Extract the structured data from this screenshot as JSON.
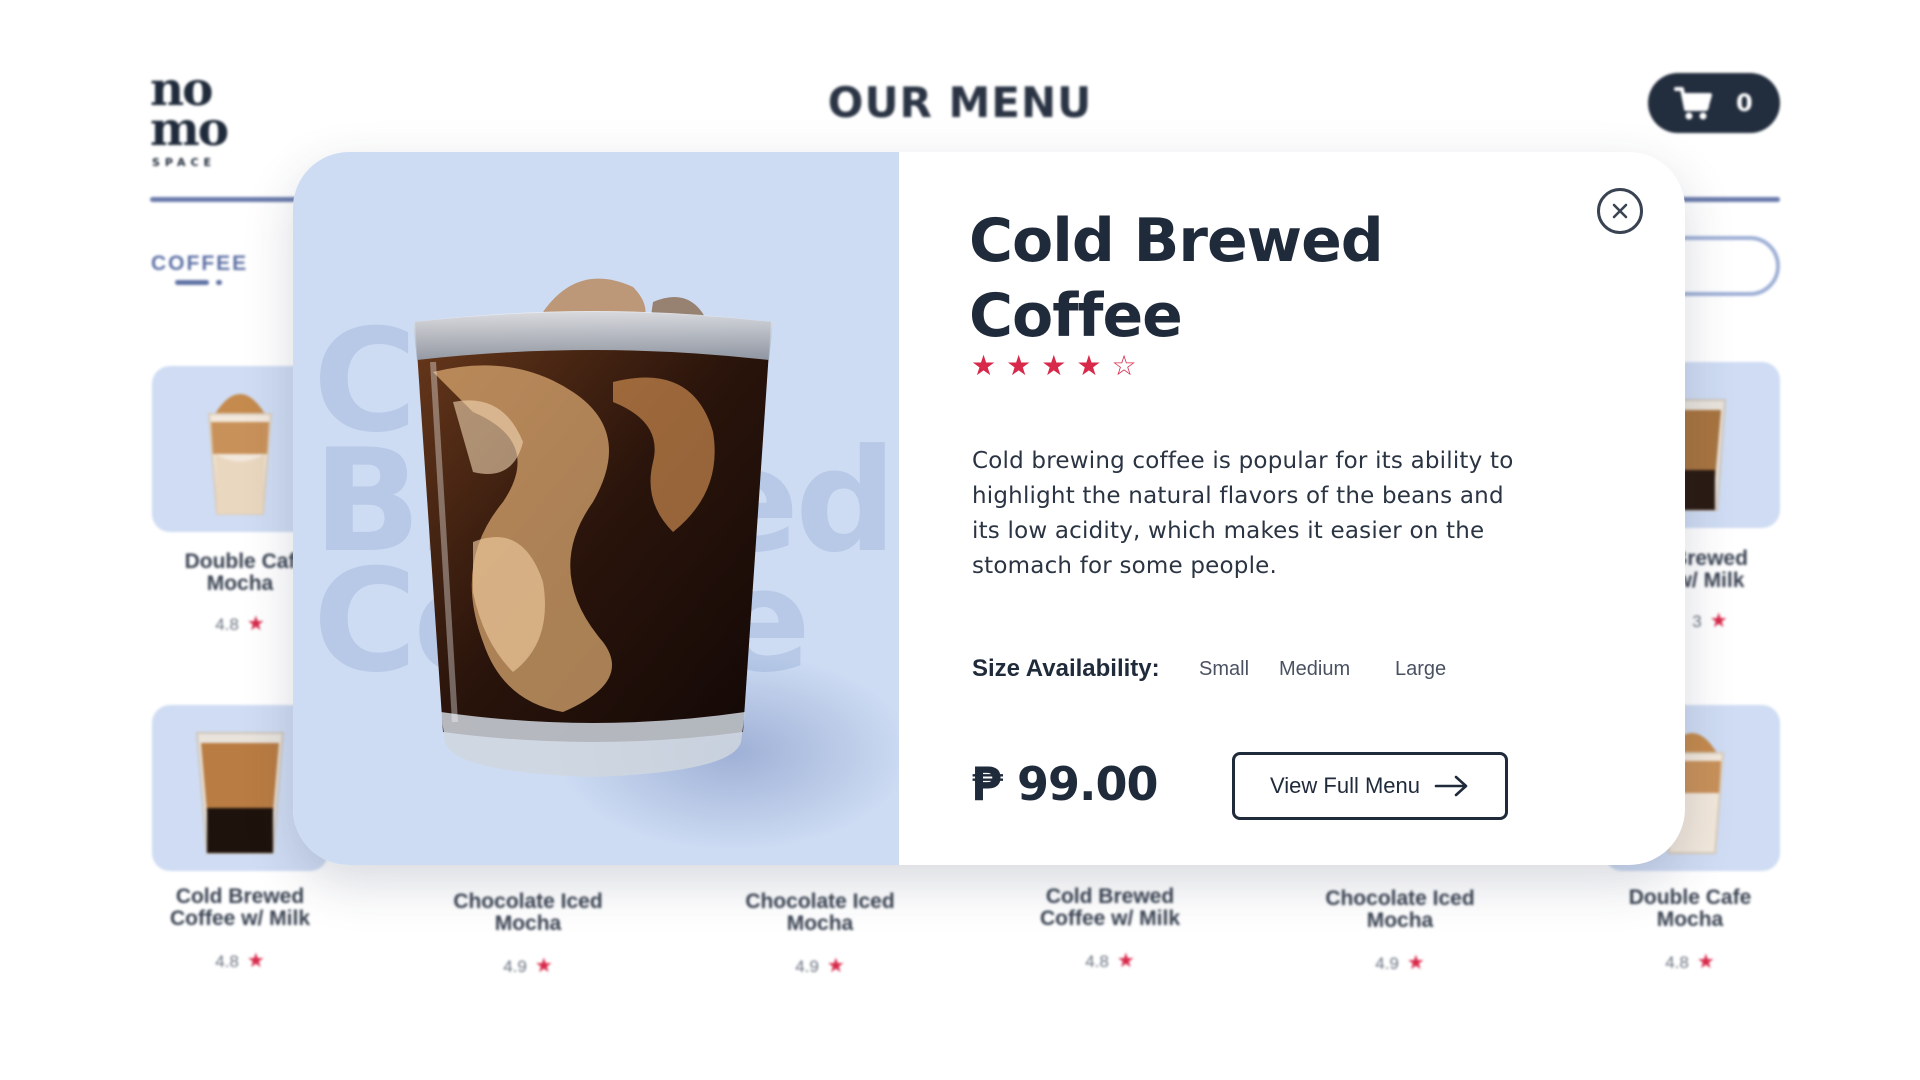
{
  "header": {
    "logo_line1": "no",
    "logo_line2": "mo",
    "logo_sub": "SPACE",
    "title": "OUR MENU",
    "cart_count": "0"
  },
  "category_tab": "COFFEE",
  "cards": [
    {
      "name": "Double Caf\nMocha",
      "name_display": "Double Caf",
      "name_line2": "Mocha",
      "rating": "4.8"
    },
    {
      "name_display": "Brewed",
      "name_line2": "w/ Milk",
      "rating": "3"
    },
    {
      "name_display": "Cold Brewed",
      "name_line2": "Coffee w/ Milk",
      "rating": "4.8"
    },
    {
      "name_display": "Chocolate Iced",
      "name_line2": "Mocha",
      "rating": "4.9"
    },
    {
      "name_display": "Chocolate Iced",
      "name_line2": "Mocha",
      "rating": "4.9"
    },
    {
      "name_display": "Cold Brewed",
      "name_line2": "Coffee w/ Milk",
      "rating": "4.8"
    },
    {
      "name_display": "Chocolate Iced",
      "name_line2": "Mocha",
      "rating": "4.9"
    },
    {
      "name_display": "Double Cafe",
      "name_line2": "Mocha",
      "rating": "4.8"
    }
  ],
  "modal": {
    "ghost_line1": "Cold",
    "ghost_line2": "Brewed",
    "ghost_line3": "Coffee",
    "title_line1": "Cold Brewed",
    "title_line2": "Coffee",
    "rating_stars": 4,
    "rating_max": 5,
    "description": "Cold brewing coffee is popular for its ability to highlight the natural flavors of the beans and its low acidity, which makes it easier on the stomach for some people.",
    "size_label": "Size Availability:",
    "sizes": [
      "Small",
      "Medium",
      "Large"
    ],
    "price": "₱ 99.00",
    "view_button": "View Full Menu"
  },
  "colors": {
    "accent_star": "#d8294a",
    "navy": "#1f2a3a",
    "card_bg": "#cfdcf3"
  }
}
